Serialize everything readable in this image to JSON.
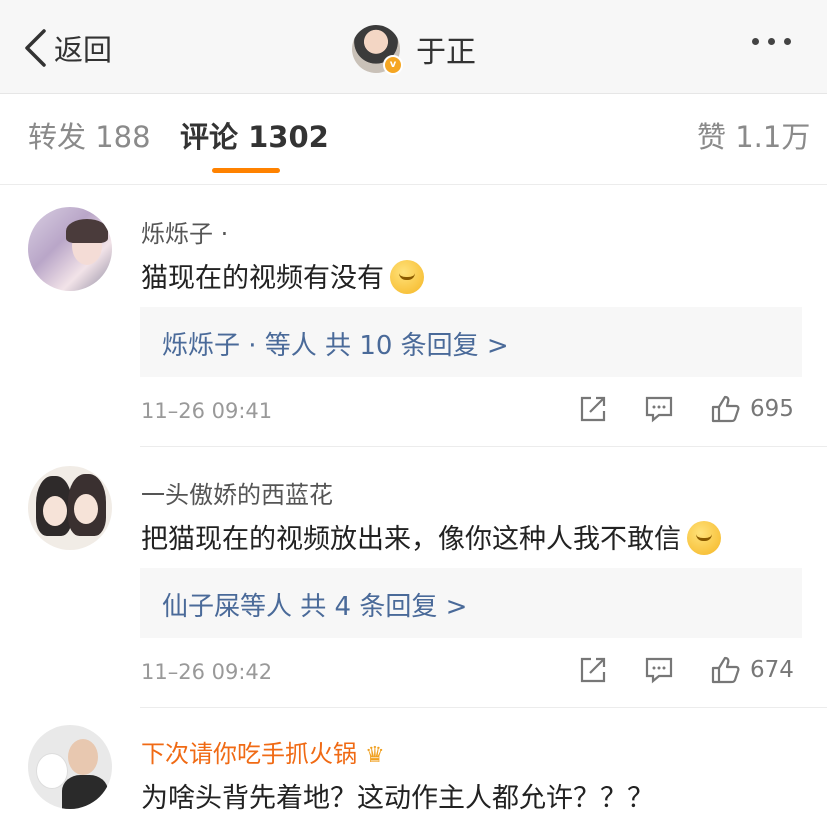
{
  "nav": {
    "back_label": "返回",
    "user_name": "于正",
    "accent": "#ff8200"
  },
  "tabs": {
    "repost": "转发 188",
    "comment": "评论 1302",
    "like": "赞 1.1万"
  },
  "comments": [
    {
      "name": "烁烁子 ·",
      "text": "猫现在的视频有没有",
      "emoji": "thinking-emoji",
      "reply_summary": "烁烁子 · 等人  共 10 条回复 >",
      "time": "11–26 09:41",
      "likes": "695"
    },
    {
      "name": "一头傲娇的西蓝花",
      "text": "把猫现在的视频放出来，像你这种人我不敢信",
      "emoji": "smirk-emoji",
      "reply_summary": "仙子屎等人  共 4 条回复 >",
      "time": "11–26 09:42",
      "likes": "674"
    },
    {
      "name": "下次请你吃手抓火锅",
      "name_color": "#f06a14",
      "badge": "crown-icon",
      "text": "为啥头背先着地？这动作主人都允许？？？"
    }
  ]
}
